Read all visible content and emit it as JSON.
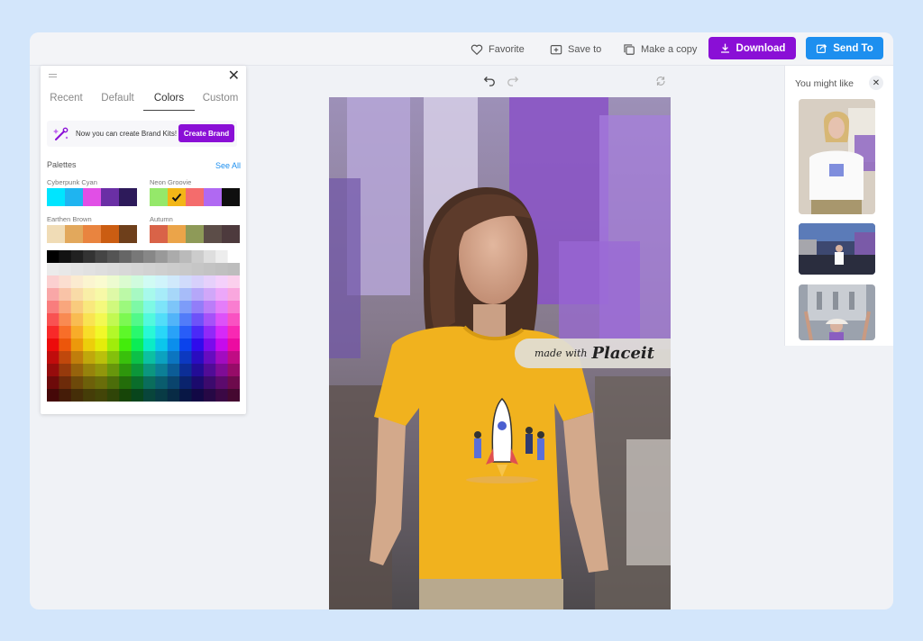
{
  "toolbar": {
    "favorite": "Favorite",
    "save_to": "Save to",
    "make_copy": "Make a copy",
    "download": "Download",
    "send_to": "Send To"
  },
  "left_panel": {
    "close": "✕",
    "tabs": [
      {
        "label": "Recent"
      },
      {
        "label": "Default"
      },
      {
        "label": "Colors"
      },
      {
        "label": "Custom"
      }
    ],
    "active_tab": "Colors",
    "brand_banner": {
      "text": "Now you can create Brand Kits!",
      "button": "Create Brand"
    },
    "palettes_label": "Palettes",
    "see_all": "See All",
    "palettes": [
      {
        "name": "Cyberpunk Cyan",
        "colors": [
          "#00e5ff",
          "#1fb4f0",
          "#e14fe6",
          "#6a2fa5",
          "#2d1a5a"
        ]
      },
      {
        "name": "Neon Groovie",
        "colors": [
          "#95e86a",
          "#f2b617",
          "#f46c6c",
          "#b069f2",
          "#0f0f0f"
        ],
        "selected_index": 1
      },
      {
        "name": "Earthen Brown",
        "colors": [
          "#f0dcb6",
          "#e2a85c",
          "#e9843f",
          "#cb5d12",
          "#6e3f1b"
        ]
      },
      {
        "name": "Autumn",
        "colors": [
          "#d96348",
          "#eba449",
          "#8e9a58",
          "#5c4d48",
          "#4d3a3d"
        ]
      }
    ]
  },
  "canvas": {
    "watermark_small": "made with",
    "watermark_brand": "Placeit"
  },
  "right_panel": {
    "title": "You might like",
    "close": "✕"
  },
  "colors": {
    "brand_purple": "#8a0fd6",
    "brand_blue": "#1d8fef"
  }
}
